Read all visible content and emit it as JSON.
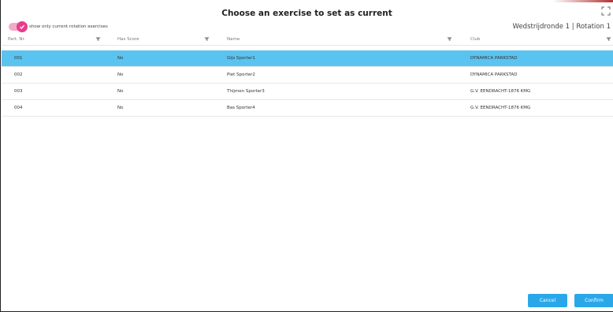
{
  "dialog": {
    "title": "Choose an exercise to set as current",
    "toggle_label": "show only current rotation exercises",
    "context": "Wedstrijdronde 1 | Rotation 1",
    "expand_icon": "expand-icon"
  },
  "table": {
    "columns": [
      "Part. Nr.",
      "Has Score",
      "Name",
      "Club"
    ],
    "rows": [
      {
        "part_nr": "001",
        "has_score": "No",
        "name": "Gijs Sporter1",
        "club": "DYNAMICA PARKSTAD",
        "selected": true
      },
      {
        "part_nr": "002",
        "has_score": "No",
        "name": "Piet Sporter2",
        "club": "DYNAMICA PARKSTAD",
        "selected": false
      },
      {
        "part_nr": "003",
        "has_score": "No",
        "name": "Thijmen Sporter3",
        "club": "G.V. EENDRACHT-1876 KMG",
        "selected": false
      },
      {
        "part_nr": "004",
        "has_score": "No",
        "name": "Bas Sporter4",
        "club": "G.V. EENDRACHT-1876 KMG",
        "selected": false
      }
    ]
  },
  "footer": {
    "cancel_label": "Cancel",
    "confirm_label": "Confirm"
  },
  "colors": {
    "selected_row": "#5bc3ef",
    "toggle_accent": "#e63e8b",
    "button": "#29a8e9"
  }
}
